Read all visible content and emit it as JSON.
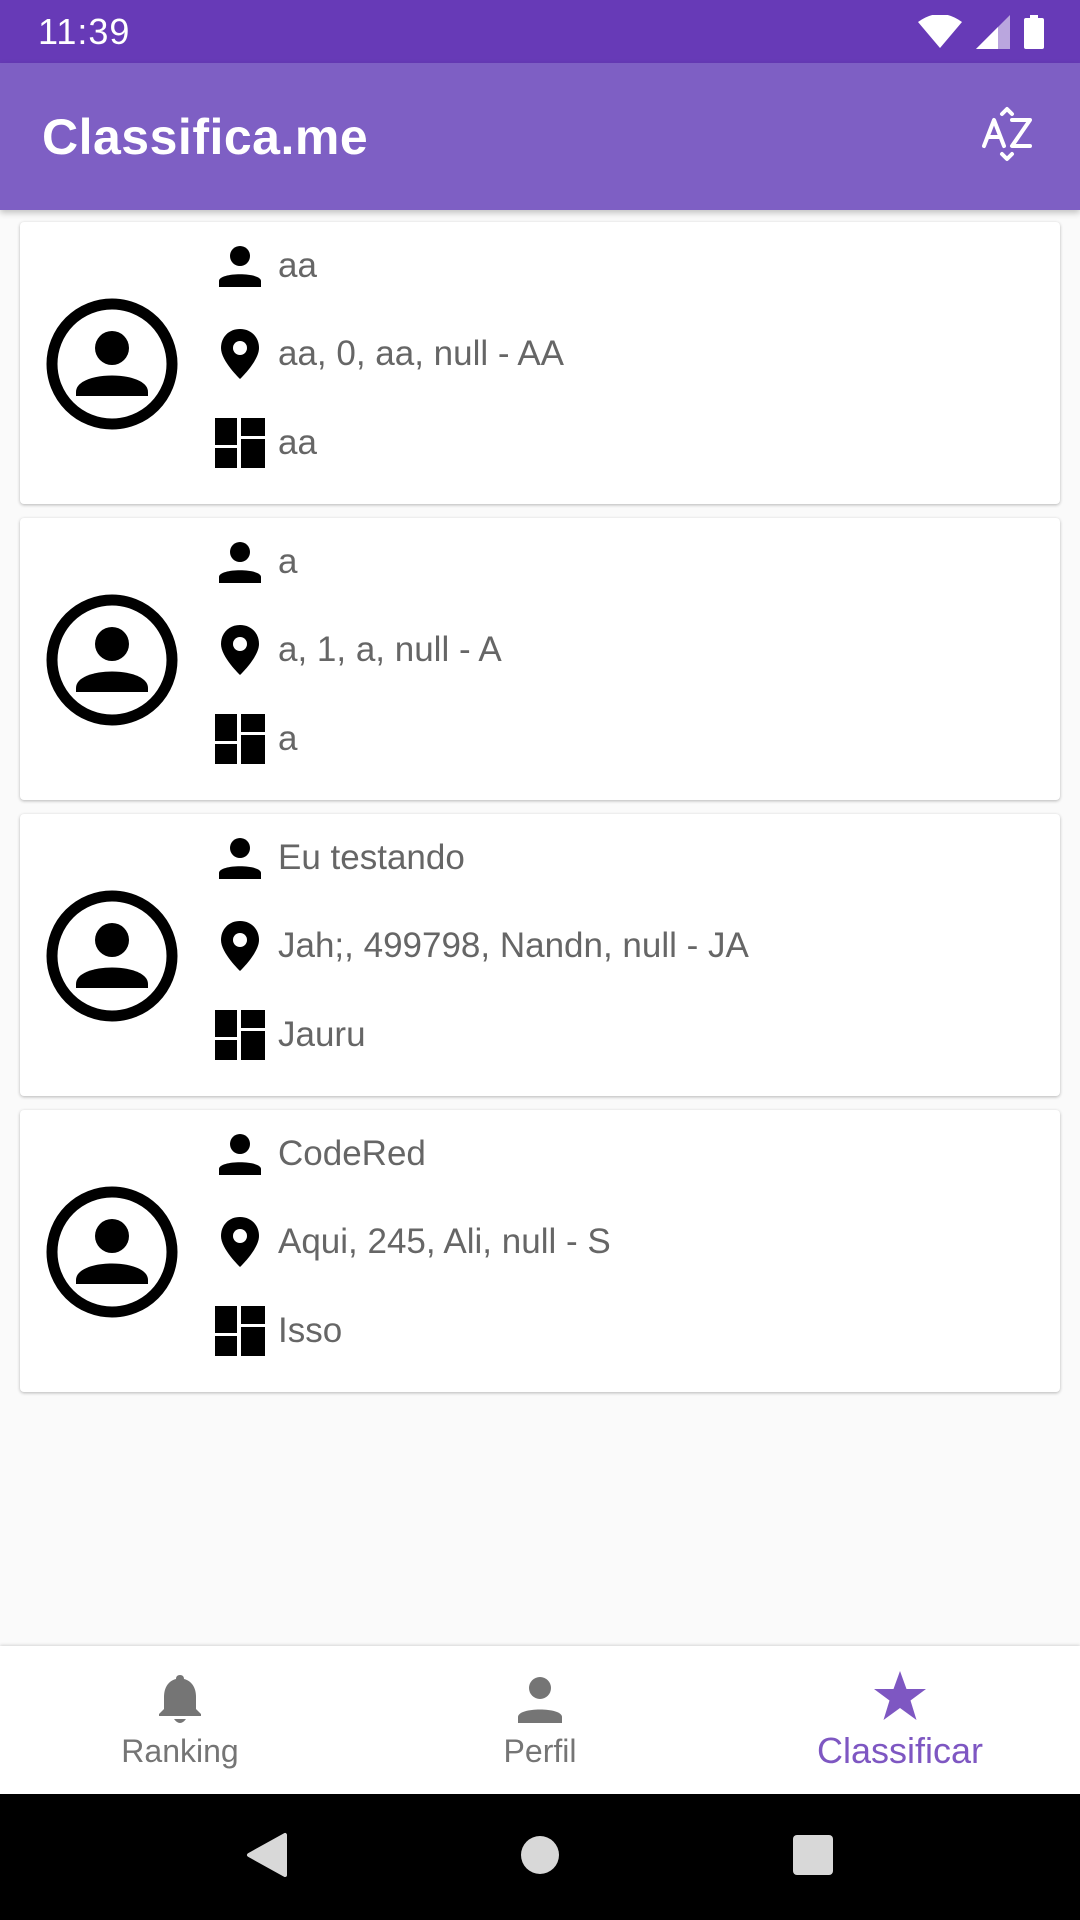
{
  "status_bar": {
    "time": "11:39"
  },
  "app_bar": {
    "title": "Classifica.me",
    "sort_icon": "sort-alphabetical-icon"
  },
  "items": [
    {
      "name": "aa",
      "address": "aa, 0, aa, null - AA",
      "category": "aa"
    },
    {
      "name": "a",
      "address": "a, 1, a, null - A",
      "category": "a"
    },
    {
      "name": "Eu testando",
      "address": "Jah;, 499798, Nandn, null - JA",
      "category": "Jauru"
    },
    {
      "name": "CodeRed",
      "address": "Aqui, 245, Ali, null - S",
      "category": "Isso"
    }
  ],
  "bottom_nav": {
    "items": [
      {
        "label": "Ranking",
        "icon": "bell-icon",
        "active": false
      },
      {
        "label": "Perfil",
        "icon": "person-icon",
        "active": false
      },
      {
        "label": "Classificar",
        "icon": "star-icon",
        "active": true
      }
    ]
  },
  "colors": {
    "status_bar": "#673ab7",
    "app_bar": "#7e5fc4",
    "accent": "#7e57c2",
    "inactive": "#757575"
  }
}
